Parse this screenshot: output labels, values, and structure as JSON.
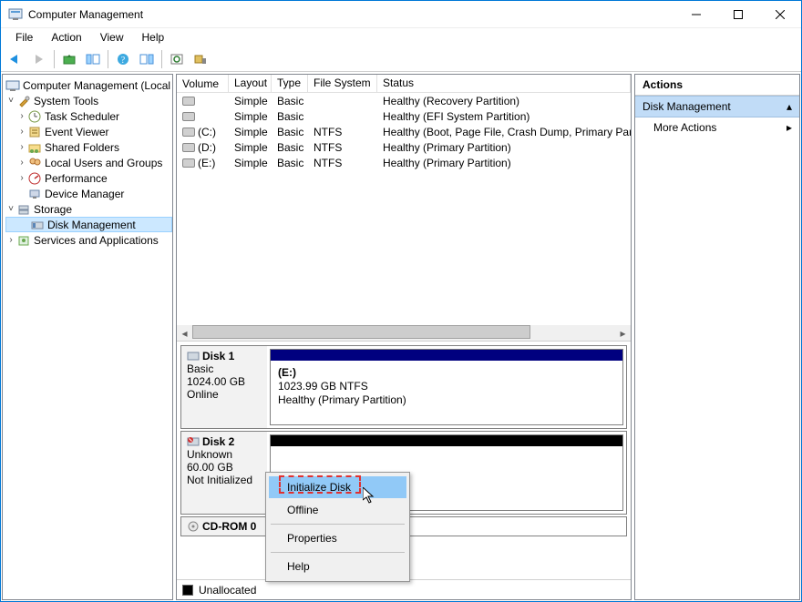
{
  "window": {
    "title": "Computer Management"
  },
  "menus": {
    "file": "File",
    "action": "Action",
    "view": "View",
    "help": "Help"
  },
  "tree": {
    "root": "Computer Management (Local",
    "system_tools": "System Tools",
    "task_scheduler": "Task Scheduler",
    "event_viewer": "Event Viewer",
    "shared_folders": "Shared Folders",
    "local_users": "Local Users and Groups",
    "performance": "Performance",
    "device_manager": "Device Manager",
    "storage": "Storage",
    "disk_management": "Disk Management",
    "services_apps": "Services and Applications"
  },
  "columns": {
    "volume": "Volume",
    "layout": "Layout",
    "type": "Type",
    "fs": "File System",
    "status": "Status"
  },
  "volumes": [
    {
      "name": "",
      "layout": "Simple",
      "type": "Basic",
      "fs": "",
      "status": "Healthy (Recovery Partition)"
    },
    {
      "name": "",
      "layout": "Simple",
      "type": "Basic",
      "fs": "",
      "status": "Healthy (EFI System Partition)"
    },
    {
      "name": "(C:)",
      "layout": "Simple",
      "type": "Basic",
      "fs": "NTFS",
      "status": "Healthy (Boot, Page File, Crash Dump, Primary Parti"
    },
    {
      "name": "(D:)",
      "layout": "Simple",
      "type": "Basic",
      "fs": "NTFS",
      "status": "Healthy (Primary Partition)"
    },
    {
      "name": "(E:)",
      "layout": "Simple",
      "type": "Basic",
      "fs": "NTFS",
      "status": "Healthy (Primary Partition)"
    }
  ],
  "disk1": {
    "title": "Disk 1",
    "type": "Basic",
    "size": "1024.00 GB",
    "state": "Online",
    "part_label": "(E:)",
    "part_size": "1023.99 GB NTFS",
    "part_status": "Healthy (Primary Partition)"
  },
  "disk2": {
    "title": "Disk 2",
    "type": "Unknown",
    "size": "60.00 GB",
    "state": "Not Initialized"
  },
  "cdrom": {
    "title": "CD-ROM 0"
  },
  "legend": {
    "unallocated": "Unallocated"
  },
  "actions": {
    "header": "Actions",
    "disk_mgmt": "Disk Management",
    "more": "More Actions"
  },
  "context": {
    "init": "Initialize Disk",
    "offline": "Offline",
    "props": "Properties",
    "help": "Help"
  }
}
